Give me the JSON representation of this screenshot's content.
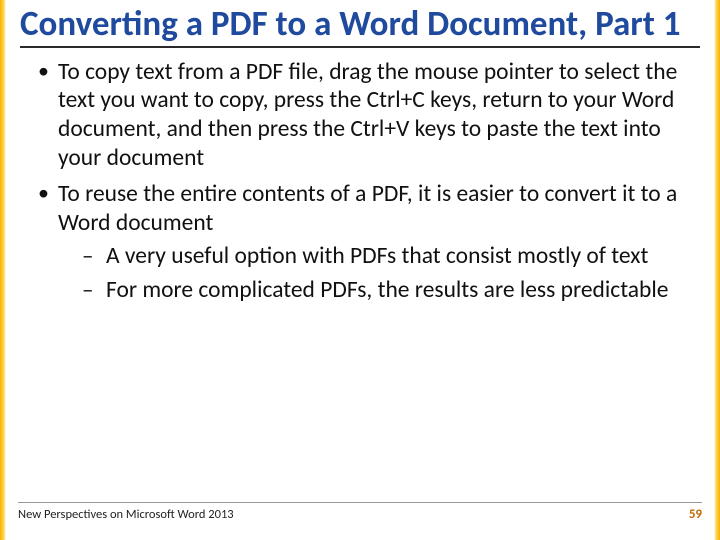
{
  "title": "Converting a PDF to a Word Document, Part 1",
  "bullets": [
    {
      "text": "To copy text from a PDF file, drag the mouse pointer to select the text you want to copy, press the Ctrl+C keys, return to your Word document, and then press the Ctrl+V keys to paste the text into your document",
      "sub": []
    },
    {
      "text": "To reuse the entire contents of a PDF, it is easier to convert it to a Word document",
      "sub": [
        "A very useful option with PDFs that consist mostly of text",
        "For more complicated PDFs, the results are less predictable"
      ]
    }
  ],
  "footer": {
    "left": "New Perspectives on Microsoft Word 2013",
    "page": "59"
  },
  "colors": {
    "title": "#1f4a9e",
    "accent": "#f5b400"
  }
}
